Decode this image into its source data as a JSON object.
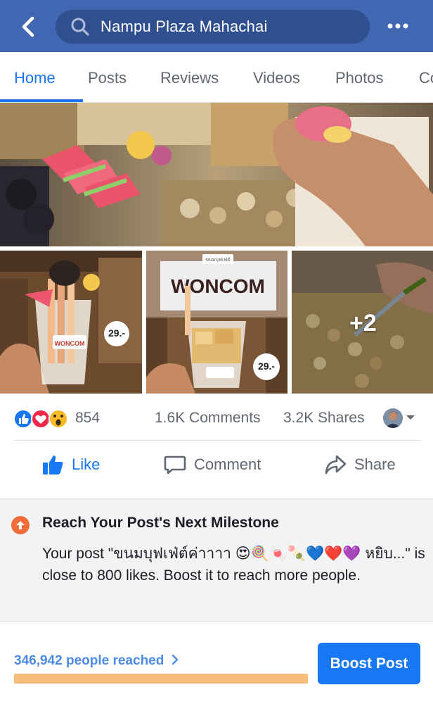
{
  "header": {
    "search_value": "Nampu Plaza Mahachai",
    "back_icon": "chevron-left-icon",
    "more_icon": "more-dots-icon",
    "bar_color": "#4267b2"
  },
  "tabs": [
    {
      "label": "Home",
      "active": true
    },
    {
      "label": "Posts"
    },
    {
      "label": "Reviews"
    },
    {
      "label": "Videos"
    },
    {
      "label": "Photos"
    },
    {
      "label": "Co"
    }
  ],
  "photos": {
    "more_count": "+2",
    "price_label_1": "29.-",
    "price_label_2": "29.-",
    "brand_sign": "WONCOM",
    "brand_tag": "ขนมบุฟเฟ่ต์"
  },
  "reactions": {
    "count": "854",
    "comments": "1.6K Comments",
    "shares": "3.2K Shares",
    "types": [
      "like",
      "love",
      "wow"
    ]
  },
  "actions": {
    "like": "Like",
    "comment": "Comment",
    "share": "Share"
  },
  "milestone": {
    "title": "Reach Your Post's Next Milestone",
    "body_prefix": "Your post \"ขนมบุฟเฟ่ต์ค่าาาา",
    "emojis": "😍🍭🍬🍡💙❤️💜",
    "body_suffix": "หยิบ...\" is close to 800 likes. Boost it to reach more people."
  },
  "footer": {
    "reach_text": "346,942 people reached",
    "progress_percent": 100,
    "boost_label": "Boost Post"
  }
}
